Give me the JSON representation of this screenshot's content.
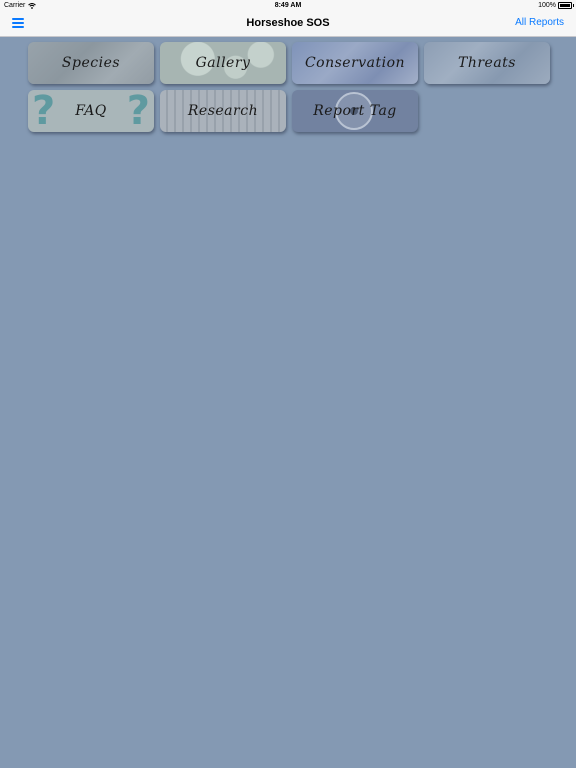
{
  "status_bar": {
    "carrier": "Carrier",
    "time": "8:49 AM",
    "battery": "100%"
  },
  "nav": {
    "title": "Horseshoe SOS",
    "right_action": "All Reports"
  },
  "tiles": [
    {
      "label": "Species"
    },
    {
      "label": "Gallery"
    },
    {
      "label": "Conservation"
    },
    {
      "label": "Threats"
    },
    {
      "label": "FAQ"
    },
    {
      "label": "Research"
    },
    {
      "label": "Report Tag"
    }
  ],
  "colors": {
    "background": "#8499b3",
    "accent": "#0a7aff",
    "nav_bg": "#f7f7f7"
  }
}
